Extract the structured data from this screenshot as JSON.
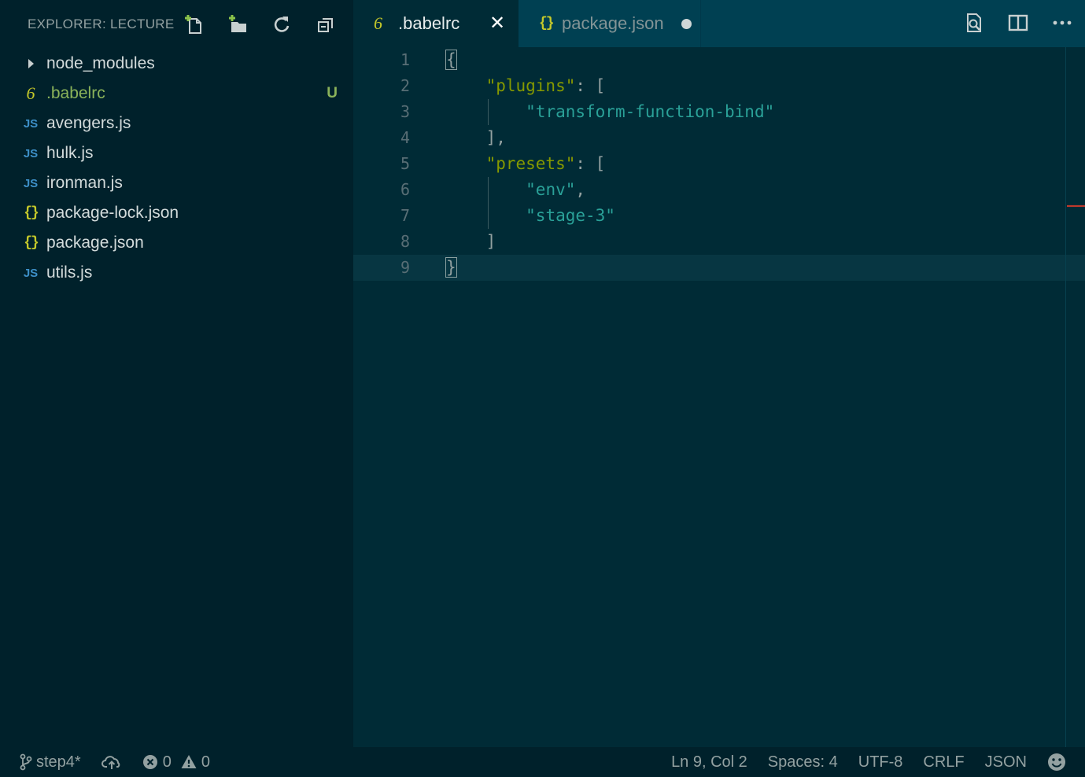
{
  "sidebar": {
    "title": "EXPLORER: LECTURE",
    "actions": [
      "new-file-icon",
      "new-folder-icon",
      "refresh-icon",
      "collapse-all-icon"
    ],
    "items": [
      {
        "name": "node_modules",
        "type": "folder"
      },
      {
        "name": ".babelrc",
        "type": "babel",
        "badge": "U",
        "color": "#8bb35a"
      },
      {
        "name": "avengers.js",
        "type": "js"
      },
      {
        "name": "hulk.js",
        "type": "js"
      },
      {
        "name": "ironman.js",
        "type": "js"
      },
      {
        "name": "package-lock.json",
        "type": "json"
      },
      {
        "name": "package.json",
        "type": "json"
      },
      {
        "name": "utils.js",
        "type": "js"
      }
    ]
  },
  "icons": {
    "js": "JS",
    "json": "{}",
    "babel": "6"
  },
  "tabs": [
    {
      "label": ".babelrc",
      "active": true
    },
    {
      "label": "package.json",
      "dirty": true
    }
  ],
  "editor": {
    "line_numbers": [
      "1",
      "2",
      "3",
      "4",
      "5",
      "6",
      "7",
      "8",
      "9"
    ],
    "lines": [
      {
        "tokens": [
          {
            "t": "{",
            "c": "p"
          }
        ]
      },
      {
        "tokens": [
          {
            "t": "    "
          },
          {
            "t": "\"plugins\"",
            "c": "k"
          },
          {
            "t": ": [",
            "c": "p"
          }
        ]
      },
      {
        "tokens": [
          {
            "t": "        "
          },
          {
            "t": "\"transform-function-bind\"",
            "c": "s"
          }
        ]
      },
      {
        "tokens": [
          {
            "t": "    ],",
            "c": "p"
          }
        ]
      },
      {
        "tokens": [
          {
            "t": "    "
          },
          {
            "t": "\"presets\"",
            "c": "k"
          },
          {
            "t": ": [",
            "c": "p"
          }
        ]
      },
      {
        "tokens": [
          {
            "t": "        "
          },
          {
            "t": "\"env\"",
            "c": "s"
          },
          {
            "t": ",",
            "c": "p"
          }
        ]
      },
      {
        "tokens": [
          {
            "t": "        "
          },
          {
            "t": "\"stage-3\"",
            "c": "s"
          }
        ]
      },
      {
        "tokens": [
          {
            "t": "    ]",
            "c": "p"
          }
        ]
      },
      {
        "tokens": [
          {
            "t": "}",
            "c": "p"
          }
        ]
      }
    ],
    "current_line": 9
  },
  "status": {
    "branch": "step4*",
    "errors": "0",
    "warnings": "0",
    "position": "Ln 9, Col 2",
    "spaces": "Spaces: 4",
    "encoding": "UTF-8",
    "eol": "CRLF",
    "language": "JSON"
  },
  "colors": {
    "sidebar_bg": "#00212b",
    "editor_bg": "#002b36",
    "tab_bar_bg": "#004052",
    "keyword": "#859900",
    "string": "#2aa198",
    "js_icon": "#3d90c8",
    "json_icon": "#c5c92a"
  }
}
